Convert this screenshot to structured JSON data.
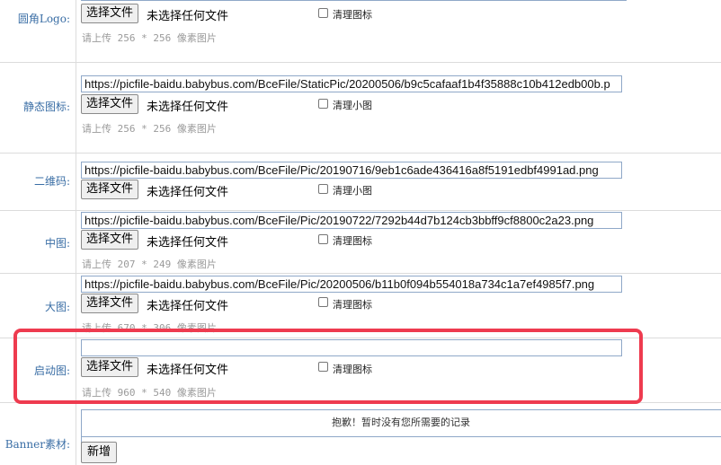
{
  "rows": [
    {
      "label": "圆角Logo:",
      "url": null,
      "button": "选择文件",
      "no_file": "未选择任何文件",
      "checkbox_label": "清理图标",
      "hint": "请上传 256 * 256 像素图片"
    },
    {
      "label": "静态图标:",
      "url": "https://picfile-baidu.babybus.com/BceFile/StaticPic/20200506/b9c5cafaaf1b4f35888c10b412edb00b.p",
      "button": "选择文件",
      "no_file": "未选择任何文件",
      "checkbox_label": "清理小图",
      "hint": "请上传 256 * 256 像素图片"
    },
    {
      "label": "二维码:",
      "url": "https://picfile-baidu.babybus.com/BceFile/Pic/20190716/9eb1c6ade436416a8f5191edbf4991ad.png",
      "button": "选择文件",
      "no_file": "未选择任何文件",
      "checkbox_label": "清理小图",
      "hint": null
    },
    {
      "label": "中图:",
      "url": "https://picfile-baidu.babybus.com/BceFile/Pic/20190722/7292b44d7b124cb3bbff9cf8800c2a23.png",
      "button": "选择文件",
      "no_file": "未选择任何文件",
      "checkbox_label": "清理图标",
      "hint": "请上传 207 * 249 像素图片"
    },
    {
      "label": "大图:",
      "url": "https://picfile-baidu.babybus.com/BceFile/Pic/20200506/b11b0f094b554018a734c1a7ef4985f7.png",
      "button": "选择文件",
      "no_file": "未选择任何文件",
      "checkbox_label": "清理图标",
      "hint": "请上传 670 * 306 像素图片"
    },
    {
      "label": "启动图:",
      "url": "",
      "button": "选择文件",
      "no_file": "未选择任何文件",
      "checkbox_label": "清理图标",
      "hint": "请上传 960 * 540 像素图片"
    }
  ],
  "banner": {
    "label": "Banner素材:",
    "empty_message": "抱歉！暂时没有您所需要的记录",
    "add_button": "新增"
  },
  "colors": {
    "highlight": "#ee3b4f",
    "label": "#3a6ea5",
    "hint": "#9a9a9a"
  }
}
